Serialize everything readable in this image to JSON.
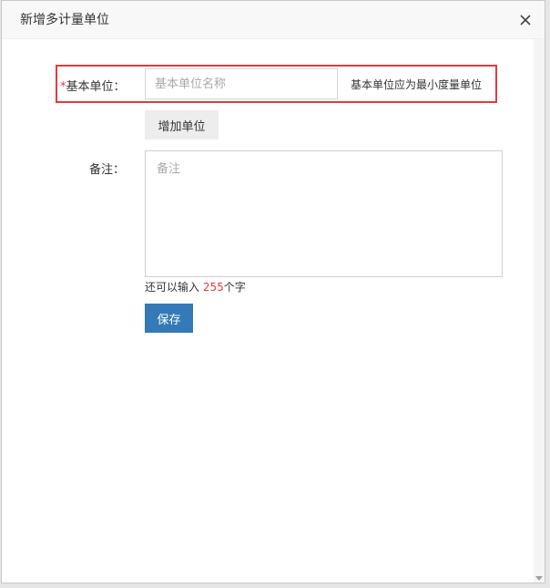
{
  "dialog": {
    "title": "新增多计量单位",
    "close_icon": "close-icon"
  },
  "form": {
    "base_unit": {
      "required_mark": "*",
      "label": "基本单位：",
      "placeholder": "基本单位名称",
      "value": "",
      "hint": "基本单位应为最小度量单位"
    },
    "add_unit_label": "增加单位",
    "remark": {
      "label": "备注：",
      "placeholder": "备注",
      "value": ""
    },
    "char_count": {
      "prefix": "还可以输入 ",
      "remaining": "255",
      "suffix": "个字"
    },
    "save_label": "保存"
  },
  "colors": {
    "highlight_border": "#e33b3b",
    "primary_button": "#337ab7",
    "required": "#e33b3b"
  }
}
